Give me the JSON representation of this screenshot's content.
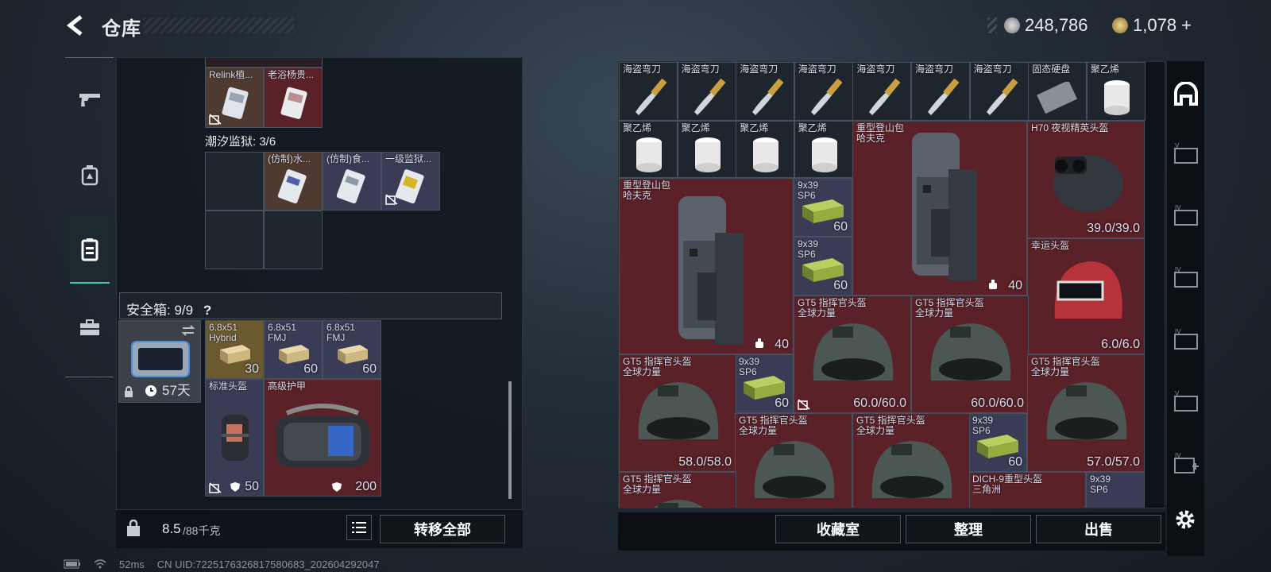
{
  "header": {
    "title": "仓库",
    "currency1": "248,786",
    "currency2": "1,078",
    "currency2_suffix": "+"
  },
  "left_tabs": [
    "gun-icon",
    "backpack-icon",
    "container-icon",
    "toolbox-icon"
  ],
  "left_panel": {
    "top_row": [
      {
        "name": "Relink植...",
        "bg": "brown"
      },
      {
        "name": "老浴杨贵...",
        "bg": "red"
      }
    ],
    "prison_label": "潮汐监狱: 3/6",
    "prison_items": [
      {
        "name": "(仿制)水...",
        "bg": "brown"
      },
      {
        "name": "(仿制)食...",
        "bg": "blue"
      },
      {
        "name": "一级监狱...",
        "bg": "blue"
      }
    ],
    "safebox_label": "安全箱: 9/9",
    "safebox_help": "?",
    "safebox_days": "57天",
    "safe_items": [
      {
        "name": "6.8x51\nHybrid",
        "count": "30"
      },
      {
        "name": "6.8x51\nFMJ",
        "count": "60"
      },
      {
        "name": "6.8x51\nFMJ",
        "count": "60"
      },
      {
        "name": "标准头盔",
        "count": "50"
      },
      {
        "name": "高级护甲",
        "count": "200"
      }
    ],
    "weight": "8.5",
    "weight_max": "/88千克",
    "transfer_all": "转移全部"
  },
  "status": {
    "latency": "52ms",
    "uid": "CN UID:7225176326817580683_202604292047"
  },
  "right_panel": {
    "row1": [
      "海盗弯刀",
      "海盗弯刀",
      "海盗弯刀",
      "海盗弯刀",
      "海盗弯刀",
      "海盗弯刀",
      "海盗弯刀",
      "固态硬盘",
      "聚乙烯"
    ],
    "row2": [
      "聚乙烯",
      "聚乙烯",
      "聚乙烯",
      "聚乙烯"
    ],
    "backpack_name": "重型登山包\n哈夫克",
    "backpack_count": "40",
    "ammo_name": "9x39\nSP6",
    "ammo_count": "60",
    "h70_name": "H70 夜视精英头盔",
    "h70_dur": "39.0/39.0",
    "lucky_name": "幸运头盔",
    "lucky_dur": "6.0/6.0",
    "gt5_name": "GT5 指挥官头盔\n全球力量",
    "gt5_dur_60": "60.0/60.0",
    "gt5_dur_58": "58.0/58.0",
    "gt5_dur_57": "57.0/57.0",
    "dich_name": "DICH-9重型头盔\n三角洲",
    "buttons": [
      "收藏室",
      "整理",
      "出售"
    ]
  }
}
